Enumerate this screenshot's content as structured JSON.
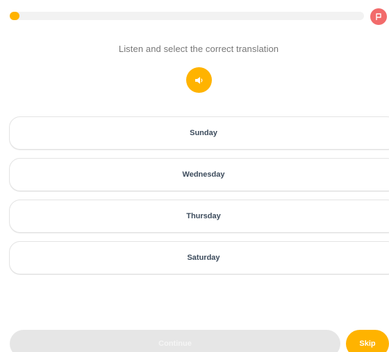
{
  "progress": {
    "fraction": 0.0,
    "color": "#ffb300",
    "track_color": "#f2f2f2"
  },
  "report": {
    "icon": "flag-icon",
    "color": "#f26b6b"
  },
  "instruction": "Listen and select the correct translation",
  "audio": {
    "icon": "speaker-icon",
    "color": "#ffb300"
  },
  "options": [
    {
      "label": "Sunday"
    },
    {
      "label": "Wednesday"
    },
    {
      "label": "Thursday"
    },
    {
      "label": "Saturday"
    }
  ],
  "footer": {
    "continue_label": "Continue",
    "skip_label": "Skip",
    "accent": "#ffb300",
    "disabled_color": "#e6e6e6"
  }
}
